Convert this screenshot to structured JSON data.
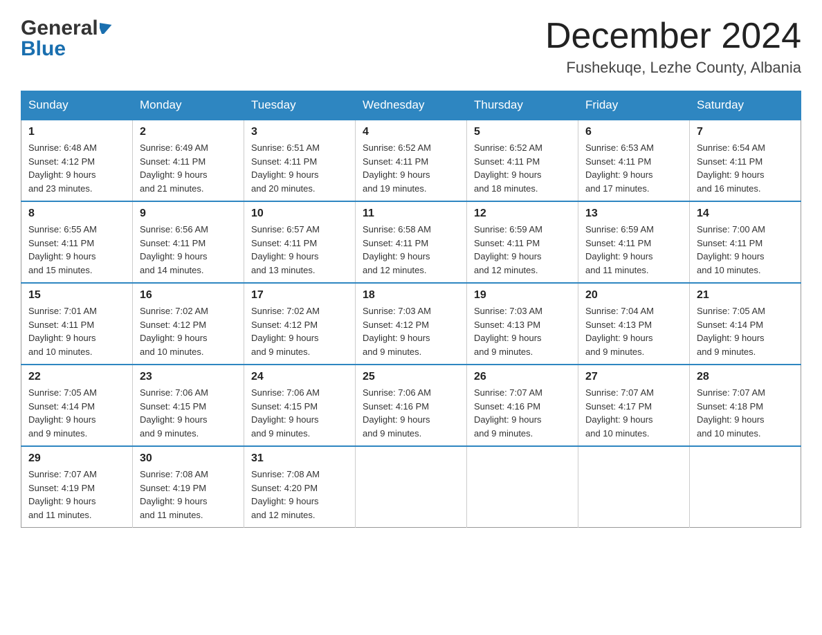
{
  "header": {
    "logo_general": "General",
    "logo_blue": "Blue",
    "month_title": "December 2024",
    "location": "Fushekuqe, Lezhe County, Albania"
  },
  "weekdays": [
    "Sunday",
    "Monday",
    "Tuesday",
    "Wednesday",
    "Thursday",
    "Friday",
    "Saturday"
  ],
  "weeks": [
    [
      {
        "day": "1",
        "sunrise": "6:48 AM",
        "sunset": "4:12 PM",
        "daylight": "9 hours and 23 minutes."
      },
      {
        "day": "2",
        "sunrise": "6:49 AM",
        "sunset": "4:11 PM",
        "daylight": "9 hours and 21 minutes."
      },
      {
        "day": "3",
        "sunrise": "6:51 AM",
        "sunset": "4:11 PM",
        "daylight": "9 hours and 20 minutes."
      },
      {
        "day": "4",
        "sunrise": "6:52 AM",
        "sunset": "4:11 PM",
        "daylight": "9 hours and 19 minutes."
      },
      {
        "day": "5",
        "sunrise": "6:52 AM",
        "sunset": "4:11 PM",
        "daylight": "9 hours and 18 minutes."
      },
      {
        "day": "6",
        "sunrise": "6:53 AM",
        "sunset": "4:11 PM",
        "daylight": "9 hours and 17 minutes."
      },
      {
        "day": "7",
        "sunrise": "6:54 AM",
        "sunset": "4:11 PM",
        "daylight": "9 hours and 16 minutes."
      }
    ],
    [
      {
        "day": "8",
        "sunrise": "6:55 AM",
        "sunset": "4:11 PM",
        "daylight": "9 hours and 15 minutes."
      },
      {
        "day": "9",
        "sunrise": "6:56 AM",
        "sunset": "4:11 PM",
        "daylight": "9 hours and 14 minutes."
      },
      {
        "day": "10",
        "sunrise": "6:57 AM",
        "sunset": "4:11 PM",
        "daylight": "9 hours and 13 minutes."
      },
      {
        "day": "11",
        "sunrise": "6:58 AM",
        "sunset": "4:11 PM",
        "daylight": "9 hours and 12 minutes."
      },
      {
        "day": "12",
        "sunrise": "6:59 AM",
        "sunset": "4:11 PM",
        "daylight": "9 hours and 12 minutes."
      },
      {
        "day": "13",
        "sunrise": "6:59 AM",
        "sunset": "4:11 PM",
        "daylight": "9 hours and 11 minutes."
      },
      {
        "day": "14",
        "sunrise": "7:00 AM",
        "sunset": "4:11 PM",
        "daylight": "9 hours and 10 minutes."
      }
    ],
    [
      {
        "day": "15",
        "sunrise": "7:01 AM",
        "sunset": "4:11 PM",
        "daylight": "9 hours and 10 minutes."
      },
      {
        "day": "16",
        "sunrise": "7:02 AM",
        "sunset": "4:12 PM",
        "daylight": "9 hours and 10 minutes."
      },
      {
        "day": "17",
        "sunrise": "7:02 AM",
        "sunset": "4:12 PM",
        "daylight": "9 hours and 9 minutes."
      },
      {
        "day": "18",
        "sunrise": "7:03 AM",
        "sunset": "4:12 PM",
        "daylight": "9 hours and 9 minutes."
      },
      {
        "day": "19",
        "sunrise": "7:03 AM",
        "sunset": "4:13 PM",
        "daylight": "9 hours and 9 minutes."
      },
      {
        "day": "20",
        "sunrise": "7:04 AM",
        "sunset": "4:13 PM",
        "daylight": "9 hours and 9 minutes."
      },
      {
        "day": "21",
        "sunrise": "7:05 AM",
        "sunset": "4:14 PM",
        "daylight": "9 hours and 9 minutes."
      }
    ],
    [
      {
        "day": "22",
        "sunrise": "7:05 AM",
        "sunset": "4:14 PM",
        "daylight": "9 hours and 9 minutes."
      },
      {
        "day": "23",
        "sunrise": "7:06 AM",
        "sunset": "4:15 PM",
        "daylight": "9 hours and 9 minutes."
      },
      {
        "day": "24",
        "sunrise": "7:06 AM",
        "sunset": "4:15 PM",
        "daylight": "9 hours and 9 minutes."
      },
      {
        "day": "25",
        "sunrise": "7:06 AM",
        "sunset": "4:16 PM",
        "daylight": "9 hours and 9 minutes."
      },
      {
        "day": "26",
        "sunrise": "7:07 AM",
        "sunset": "4:16 PM",
        "daylight": "9 hours and 9 minutes."
      },
      {
        "day": "27",
        "sunrise": "7:07 AM",
        "sunset": "4:17 PM",
        "daylight": "9 hours and 10 minutes."
      },
      {
        "day": "28",
        "sunrise": "7:07 AM",
        "sunset": "4:18 PM",
        "daylight": "9 hours and 10 minutes."
      }
    ],
    [
      {
        "day": "29",
        "sunrise": "7:07 AM",
        "sunset": "4:19 PM",
        "daylight": "9 hours and 11 minutes."
      },
      {
        "day": "30",
        "sunrise": "7:08 AM",
        "sunset": "4:19 PM",
        "daylight": "9 hours and 11 minutes."
      },
      {
        "day": "31",
        "sunrise": "7:08 AM",
        "sunset": "4:20 PM",
        "daylight": "9 hours and 12 minutes."
      },
      null,
      null,
      null,
      null
    ]
  ],
  "labels": {
    "sunrise": "Sunrise:",
    "sunset": "Sunset:",
    "daylight": "Daylight:"
  }
}
